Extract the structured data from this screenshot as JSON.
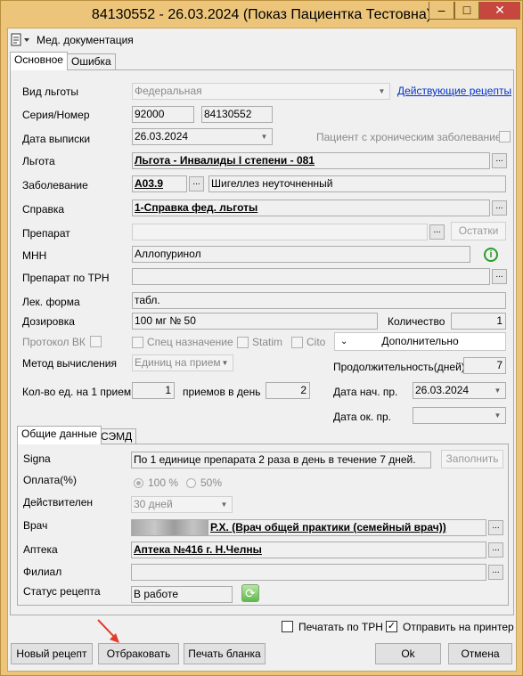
{
  "window": {
    "title": "84130552 - 26.03.2024 (Показ Пациентка Тестовна)",
    "min_glyph": "–",
    "max_glyph": "□",
    "close_glyph": "✕"
  },
  "toolbar": {
    "menu_label": "Мед. документация",
    "doc_icon": "document-icon"
  },
  "tabs_top": [
    {
      "label": "Основное",
      "active": true
    },
    {
      "label": "Ошибка",
      "active": false
    }
  ],
  "main": {
    "benefit_type_label": "Вид льготы",
    "benefit_type_value": "Федеральная",
    "active_recipes_link": "Действующие рецепты",
    "series_number_label": "Серия/Номер",
    "series_value": "92000",
    "number_value": "84130552",
    "issue_date_label": "Дата выписки",
    "issue_date_value": "26.03.2024",
    "chronic_label": "Пациент с хроническим заболеванием",
    "benefit_label": "Льгота",
    "benefit_value": "Льгота - Инвалиды I степени - 081",
    "disease_label": "Заболевание",
    "disease_code": "A03.9",
    "disease_name": "Шигеллез неуточненный",
    "certificate_label": "Справка",
    "certificate_value": "1-Справка фед. льготы",
    "drug_label": "Препарат",
    "drug_value": "",
    "remainders_button": "Остатки",
    "inn_label": "МНН",
    "inn_value": "Аллопуринол",
    "trn_drug_label": "Препарат по ТРН",
    "trn_drug_value": "",
    "form_label": "Лек. форма",
    "form_value": "табл.",
    "dosage_label": "Дозировка",
    "dosage_value": "100 мг № 50",
    "quantity_label": "Количество",
    "quantity_value": "1",
    "vk_label": "Протокол ВК",
    "special_label": "Спец назначение",
    "statim_label": "Statim",
    "cito_label": "Cito",
    "additional_button": "Дополнительно",
    "calc_method_label": "Метод вычисления",
    "calc_method_value": "Единиц на прием",
    "duration_label": "Продолжительность(дней)",
    "duration_value": "7",
    "units_label": "Кол-во ед. на 1 прием",
    "units_value": "1",
    "per_day_label": "приемов в день",
    "per_day_value": "2",
    "start_date_label": "Дата нач. пр.",
    "start_date_value": "26.03.2024",
    "end_date_label": "Дата ок. пр.",
    "end_date_value": ""
  },
  "tabs_bottom": [
    {
      "label": "Общие данные",
      "active": true
    },
    {
      "label": "СЭМД",
      "active": false
    }
  ],
  "general": {
    "signa_label": "Signa",
    "signa_value": "По 1 единице препарата 2 раза в день в течение 7 дней.",
    "fill_button": "Заполнить",
    "payment_label": "Оплата(%)",
    "pay_100": "100 %",
    "pay_50": "50%",
    "valid_label": "Действителен",
    "valid_value": "30 дней",
    "doctor_label": "Врач",
    "doctor_value": "Р.Х. (Врач общей практики (семейный врач))",
    "pharmacy_label": "Аптека",
    "pharmacy_value": "Аптека №416 г. Н.Челны",
    "branch_label": "Филиал",
    "branch_value": "",
    "status_label": "Статус рецепта",
    "status_value": "В работе"
  },
  "footer": {
    "print_trn_label": "Печатать по ТРН",
    "send_printer_label": "Отправить на принтер",
    "new_recipe_button": "Новый рецепт",
    "reject_button": "Отбраковать",
    "print_form_button": "Печать бланка",
    "ok_button": "Ok",
    "cancel_button": "Отмена"
  },
  "colors": {
    "title_bar": "#ecc57a",
    "close_button": "#c7463e",
    "link": "#0033cc",
    "annotation_arrow": "#e53a2a"
  }
}
